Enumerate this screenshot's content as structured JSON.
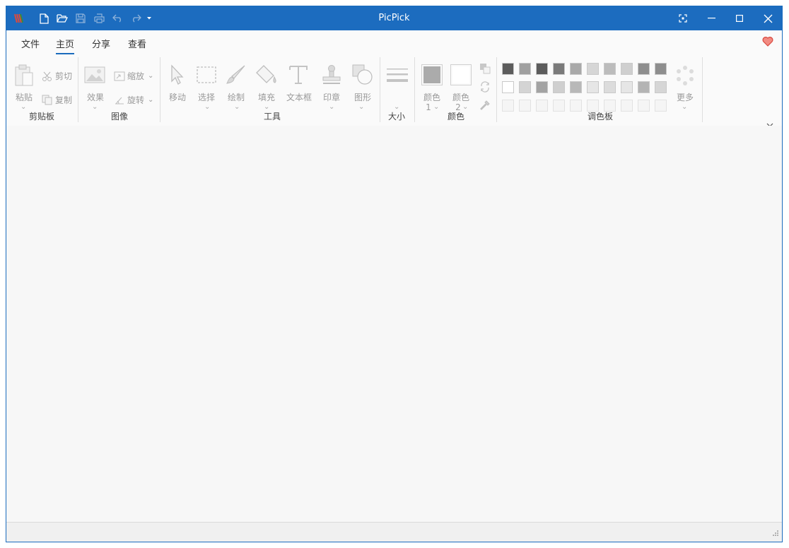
{
  "app": {
    "title": "PicPick",
    "brand_color": "#1c6cbf"
  },
  "quick_access": [
    "new-icon",
    "open-icon",
    "save-icon",
    "print-icon",
    "undo-icon",
    "redo-icon",
    "customize-dropdown-icon"
  ],
  "window_buttons": [
    "capture-icon",
    "minimize-icon",
    "maximize-icon",
    "close-icon"
  ],
  "tabs": [
    {
      "label": "文件"
    },
    {
      "label": "主页",
      "active": true
    },
    {
      "label": "分享"
    },
    {
      "label": "查看"
    }
  ],
  "ribbon": {
    "clipboard": {
      "group": "剪贴板",
      "paste": "粘贴",
      "cut": "剪切",
      "copy": "复制"
    },
    "image": {
      "group": "图像",
      "effects": "效果",
      "resize": "缩放",
      "rotate": "旋转"
    },
    "tools": {
      "group": "工具",
      "move": "移动",
      "select": "选择",
      "draw": "绘制",
      "fill": "填充",
      "textbox": "文本框",
      "stamp": "印章",
      "shape": "图形"
    },
    "size": {
      "group": "大小"
    },
    "colors": {
      "group": "颜色",
      "color1_line1": "颜色",
      "color1_line2": "1",
      "color2_line1": "颜色",
      "color2_line2": "2"
    },
    "palette": {
      "group": "调色板",
      "more": "更多",
      "rows": [
        [
          "#5c5c5c",
          "#a0a0a0",
          "#5c5c5c",
          "#7a7a7a",
          "#a9a9a9",
          "#d6d6d6",
          "#bcbcbc",
          "#cfcfcf",
          "#8e8e8e",
          "#8e8e8e"
        ],
        [
          "#ffffff",
          "#d4d4d4",
          "#a3a3a3",
          "#cfcfcf",
          "#b8b8b8",
          "#e6e6e6",
          "#dcdcdc",
          "#e6e6e6",
          "#b4b4b4",
          "#d6d6d6"
        ]
      ]
    }
  }
}
